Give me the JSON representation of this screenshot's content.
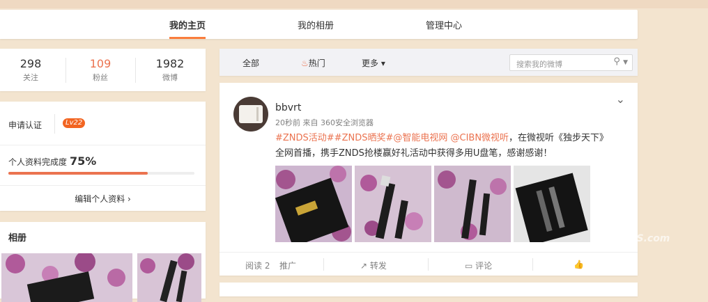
{
  "nav": {
    "tabs": [
      {
        "label": "我的主页",
        "active": true
      },
      {
        "label": "我的相册",
        "active": false
      },
      {
        "label": "管理中心",
        "active": false
      }
    ]
  },
  "stats": [
    {
      "value": "298",
      "label": "关注"
    },
    {
      "value": "109",
      "label": "粉丝"
    },
    {
      "value": "1982",
      "label": "微博"
    }
  ],
  "profile": {
    "verify_label": "申请认证",
    "level": "Lv22",
    "complete_label": "个人资料完成度",
    "complete_pct": "75%",
    "complete_value": 0.75,
    "edit_label": "编辑个人资料 ›"
  },
  "album": {
    "title": "相册"
  },
  "filter": {
    "all": "全部",
    "hot": "热门",
    "more": "更多 ▾",
    "search_placeholder": "搜索我的微博"
  },
  "post": {
    "username": "bbvrt",
    "meta": "20秒前 来自 360安全浏览器",
    "links": "#ZNDS活动##ZNDS晒奖#@智能电视网 @CIBN微视听",
    "text_after_links": "，在微视听《独步天下》",
    "text_line2": "全网首播，携手ZNDS抢楼赢好礼活动中获得多用U盘笔，感谢感谢！",
    "read": "阅读 2",
    "promote": "推广",
    "repost": "转发",
    "comment": "评论"
  },
  "watermark": "ZNDS.com",
  "colors": {
    "accent": "#eb7350",
    "tab_underline": "#fa7d3c",
    "level_badge": "#f26522"
  }
}
